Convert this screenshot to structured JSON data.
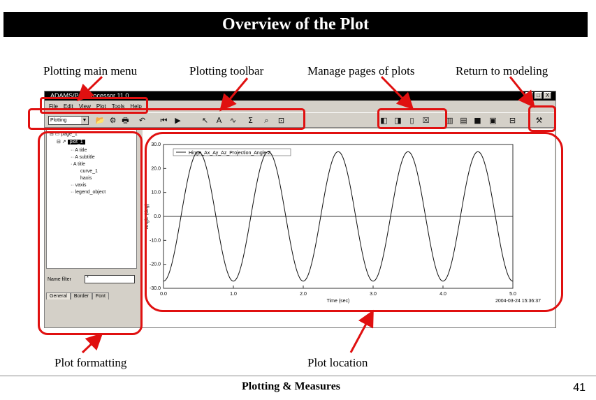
{
  "slide": {
    "title": "Overview of the Plot",
    "footer": "Plotting & Measures",
    "page_number": "41"
  },
  "callouts": {
    "main_menu": "Plotting main menu",
    "toolbar": "Plotting toolbar",
    "manage_pages": "Manage pages of plots",
    "return_modeling": "Return to modeling",
    "plot_formatting": "Plot formatting",
    "plot_location": "Plot location"
  },
  "window": {
    "title": "ADAMS/PostProcessor 11.0",
    "menu": [
      "File",
      "Edit",
      "View",
      "Plot",
      "Tools",
      "Help"
    ],
    "toolbar_mode": "Plotting",
    "close_glyph": "X",
    "min_glyph": "_",
    "max_glyph": "□"
  },
  "tree": {
    "root": "page_1",
    "selected": "plot_1",
    "items": [
      "title",
      "subtitle",
      "title",
      "curve_1",
      "haxis",
      "vaxis",
      "legend_object"
    ],
    "name_label": "Name filter",
    "name_value": "*",
    "tabs": [
      "General",
      "Border",
      "Font"
    ]
  },
  "chart_data": {
    "type": "line",
    "legend": [
      "Hinge_Ax_Ay_Az_Projection_Angle.Z"
    ],
    "ylabel": "Angle (deg)",
    "xlabel": "Time (sec)",
    "timestamp": "2004-03-24 15:36:37",
    "xlim": [
      0.0,
      5.0
    ],
    "ylim": [
      -30.0,
      30.0
    ],
    "x_ticks": [
      "0.0",
      "1.0",
      "2.0",
      "3.0",
      "4.0",
      "5.0"
    ],
    "y_ticks": [
      "30.0",
      "20.0",
      "10.0",
      "0.0",
      "-10.0",
      "-20.0",
      "-30.0"
    ],
    "series": [
      {
        "amplitude": 27.0,
        "period": 1.0,
        "phase_peak_at": 0.5
      }
    ],
    "grid": false,
    "zero_line": true
  },
  "colors": {
    "highlight": "#e01010",
    "window_bg": "#d4d0c8"
  }
}
